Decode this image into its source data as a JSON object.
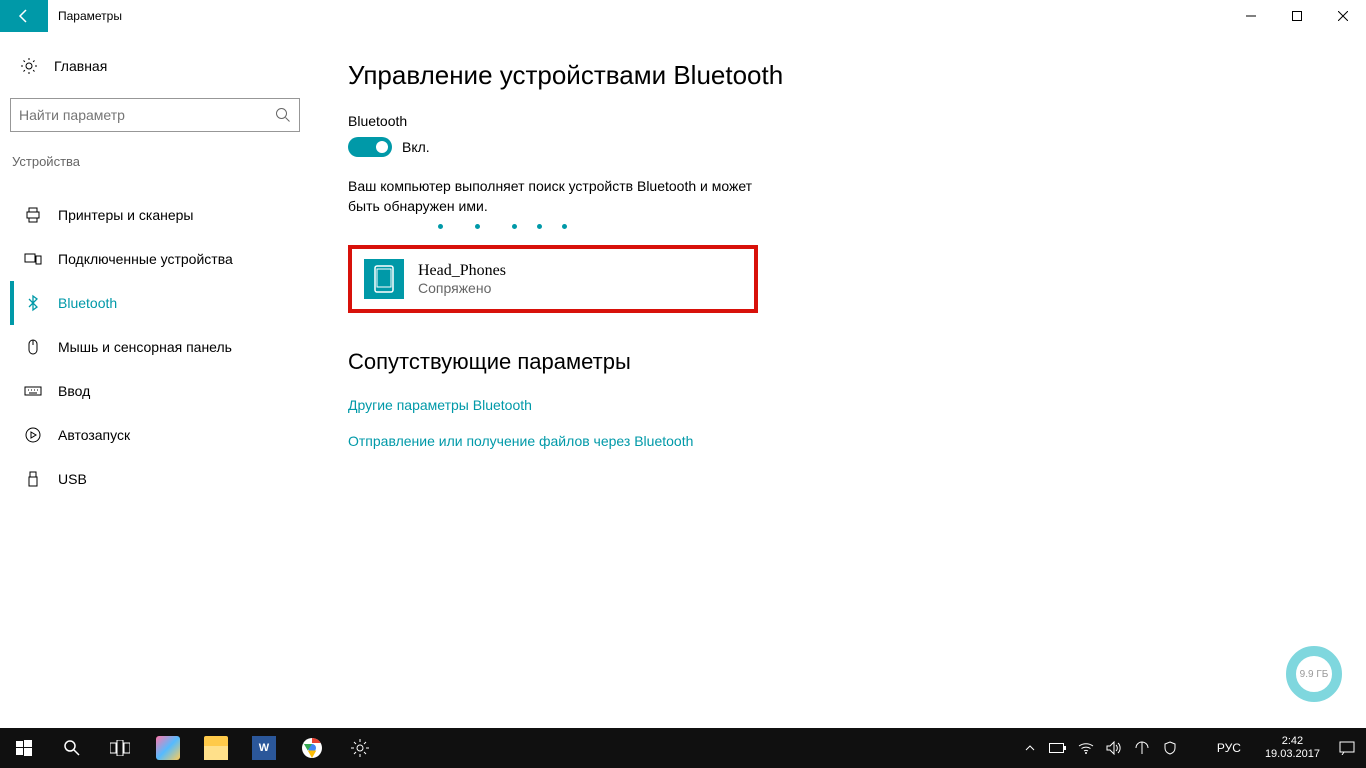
{
  "titlebar": {
    "title": "Параметры"
  },
  "sidebar": {
    "home": "Главная",
    "search_placeholder": "Найти параметр",
    "category": "Устройства",
    "items": [
      {
        "label": "Принтеры и сканеры"
      },
      {
        "label": "Подключенные устройства"
      },
      {
        "label": "Bluetooth"
      },
      {
        "label": "Мышь и сенсорная панель"
      },
      {
        "label": "Ввод"
      },
      {
        "label": "Автозапуск"
      },
      {
        "label": "USB"
      }
    ]
  },
  "main": {
    "heading": "Управление устройствами Bluetooth",
    "toggle_label": "Bluetooth",
    "toggle_state": "Вкл.",
    "search_text": "Ваш компьютер выполняет поиск устройств Bluetooth и может быть обнаружен ими.",
    "device": {
      "name": "Head_Phones",
      "state": "Сопряжено"
    },
    "related_heading": "Сопутствующие параметры",
    "link1": "Другие параметры Bluetooth",
    "link2": "Отправление или получение файлов через Bluetooth"
  },
  "badge": {
    "text": "9.9 ГБ"
  },
  "taskbar": {
    "lang": "РУС",
    "time": "2:42",
    "date": "19.03.2017"
  }
}
